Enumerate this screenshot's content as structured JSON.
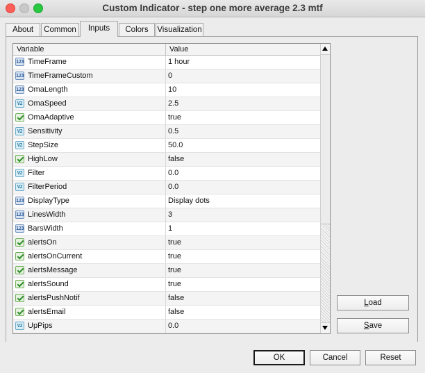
{
  "window": {
    "title": "Custom Indicator - step one more average 2.3 mtf"
  },
  "tabs": [
    {
      "label": "About",
      "active": false
    },
    {
      "label": "Common",
      "active": false
    },
    {
      "label": "Inputs",
      "active": true
    },
    {
      "label": "Colors",
      "active": false
    },
    {
      "label": "Visualization",
      "active": false
    }
  ],
  "grid": {
    "columns": {
      "variable": "Variable",
      "value": "Value"
    },
    "rows": [
      {
        "type": "int-icon",
        "variable": "TimeFrame",
        "value": "1 hour"
      },
      {
        "type": "int-icon",
        "variable": "TimeFrameCustom",
        "value": "0"
      },
      {
        "type": "int-icon",
        "variable": "OmaLength",
        "value": "10"
      },
      {
        "type": "double-icon",
        "variable": "OmaSpeed",
        "value": "2.5"
      },
      {
        "type": "bool-icon",
        "variable": "OmaAdaptive",
        "value": "true"
      },
      {
        "type": "double-icon",
        "variable": "Sensitivity",
        "value": "0.5"
      },
      {
        "type": "double-icon",
        "variable": "StepSize",
        "value": "50.0"
      },
      {
        "type": "bool-icon",
        "variable": "HighLow",
        "value": "false"
      },
      {
        "type": "double-icon",
        "variable": "Filter",
        "value": "0.0"
      },
      {
        "type": "double-icon",
        "variable": "FilterPeriod",
        "value": "0.0"
      },
      {
        "type": "int-icon",
        "variable": "DisplayType",
        "value": "Display dots"
      },
      {
        "type": "int-icon",
        "variable": "LinesWidth",
        "value": "3"
      },
      {
        "type": "int-icon",
        "variable": "BarsWidth",
        "value": "1"
      },
      {
        "type": "bool-icon",
        "variable": "alertsOn",
        "value": "true"
      },
      {
        "type": "bool-icon",
        "variable": "alertsOnCurrent",
        "value": "true"
      },
      {
        "type": "bool-icon",
        "variable": "alertsMessage",
        "value": "true"
      },
      {
        "type": "bool-icon",
        "variable": "alertsSound",
        "value": "true"
      },
      {
        "type": "bool-icon",
        "variable": "alertsPushNotif",
        "value": "false"
      },
      {
        "type": "bool-icon",
        "variable": "alertsEmail",
        "value": "false"
      },
      {
        "type": "double-icon",
        "variable": "UpPips",
        "value": "0.0"
      }
    ]
  },
  "side_buttons": {
    "load": {
      "first": "L",
      "rest": "oad"
    },
    "save": {
      "first": "S",
      "rest": "ave"
    }
  },
  "footer": {
    "ok_label": "OK",
    "cancel_label": "Cancel",
    "reset_label": "Reset"
  }
}
